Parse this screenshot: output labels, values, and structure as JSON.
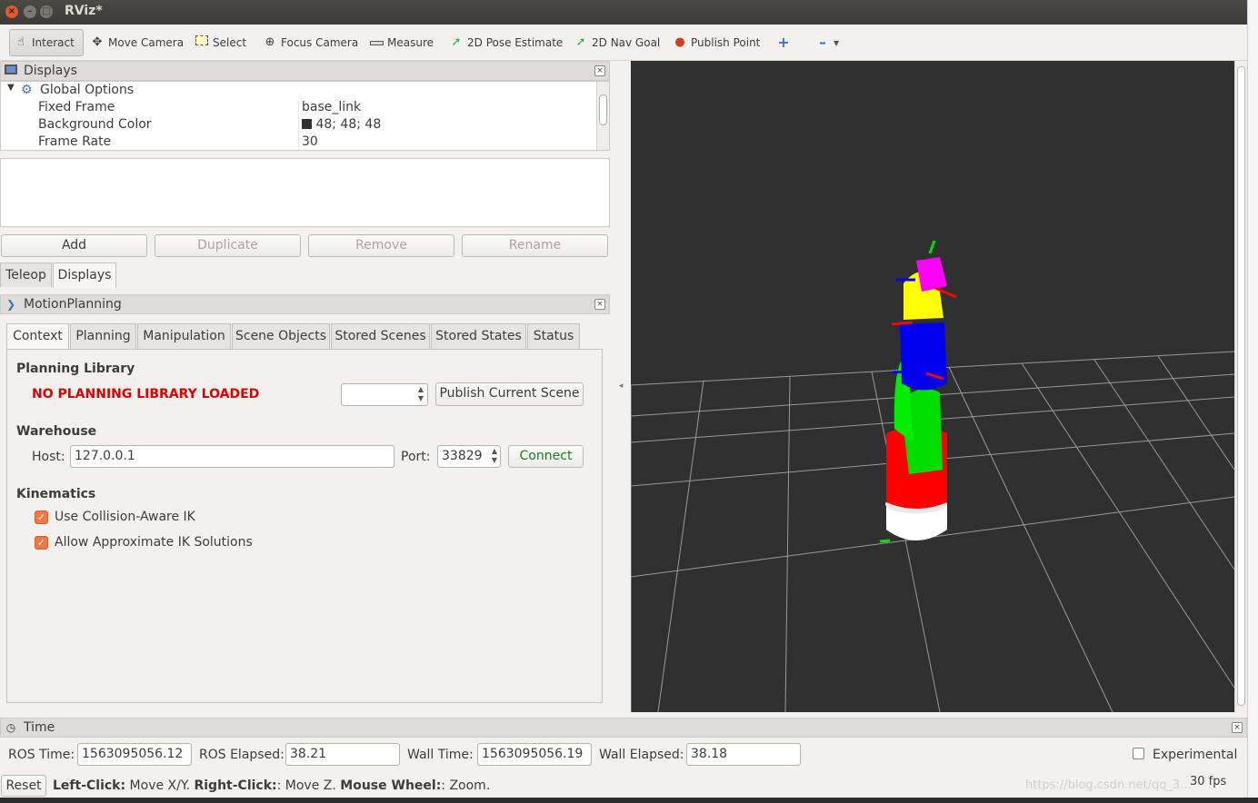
{
  "window": {
    "title": "RViz*"
  },
  "toolbar": {
    "tools": [
      {
        "label": "Interact",
        "icon": "hand-icon"
      },
      {
        "label": "Move Camera",
        "icon": "move-camera-icon"
      },
      {
        "label": "Select",
        "icon": "select-icon"
      },
      {
        "label": "Focus Camera",
        "icon": "focus-camera-icon"
      },
      {
        "label": "Measure",
        "icon": "ruler-icon"
      },
      {
        "label": "2D Pose Estimate",
        "icon": "green-arrow-icon"
      },
      {
        "label": "2D Nav Goal",
        "icon": "green-arrow-icon"
      },
      {
        "label": "Publish Point",
        "icon": "map-pin-icon"
      }
    ]
  },
  "displays_panel": {
    "title": "Displays",
    "tree": {
      "group": "Global Options",
      "rows": [
        {
          "name": "Fixed Frame",
          "value": "base_link"
        },
        {
          "name": "Background Color",
          "value": "48; 48; 48",
          "swatch": "#303030"
        },
        {
          "name": "Frame Rate",
          "value": "30"
        }
      ]
    },
    "buttons": {
      "add": "Add",
      "duplicate": "Duplicate",
      "remove": "Remove",
      "rename": "Rename"
    },
    "tabs": [
      "Teleop",
      "Displays"
    ]
  },
  "motion_panel": {
    "title": "MotionPlanning",
    "tabs": [
      "Context",
      "Planning",
      "Manipulation",
      "Scene Objects",
      "Stored Scenes",
      "Stored States",
      "Status"
    ],
    "planning_library": {
      "heading": "Planning Library",
      "status": "NO PLANNING LIBRARY LOADED",
      "publish_button": "Publish Current Scene"
    },
    "warehouse": {
      "heading": "Warehouse",
      "host_label": "Host:",
      "host_value": "127.0.0.1",
      "port_label": "Port:",
      "port_value": "33829",
      "connect_button": "Connect"
    },
    "kinematics": {
      "heading": "Kinematics",
      "options": [
        {
          "label": "Use Collision-Aware IK",
          "checked": true
        },
        {
          "label": "Allow Approximate IK Solutions",
          "checked": true
        }
      ]
    }
  },
  "time_panel": {
    "title": "Time",
    "ros_time_label": "ROS Time:",
    "ros_time": "1563095056.12",
    "ros_elapsed_label": "ROS Elapsed:",
    "ros_elapsed": "38.21",
    "wall_time_label": "Wall Time:",
    "wall_time": "1563095056.19",
    "wall_elapsed_label": "Wall Elapsed:",
    "wall_elapsed": "38.18",
    "experimental_label": "Experimental",
    "experimental_checked": false
  },
  "statusbar": {
    "reset": "Reset",
    "hint_left_key": "Left-Click:",
    "hint_left": "Move X/Y.",
    "hint_right_key": "Right-Click:",
    "hint_right": ": Move Z.",
    "hint_wheel_key": "Mouse Wheel:",
    "hint_wheel": ": Zoom.",
    "fps": "30 fps",
    "watermark": "https://blog.csdn.net/qq_3..."
  },
  "colors": {
    "accent_red": "#e00000",
    "view_background": "#303030",
    "check_orange": "#f07746"
  }
}
